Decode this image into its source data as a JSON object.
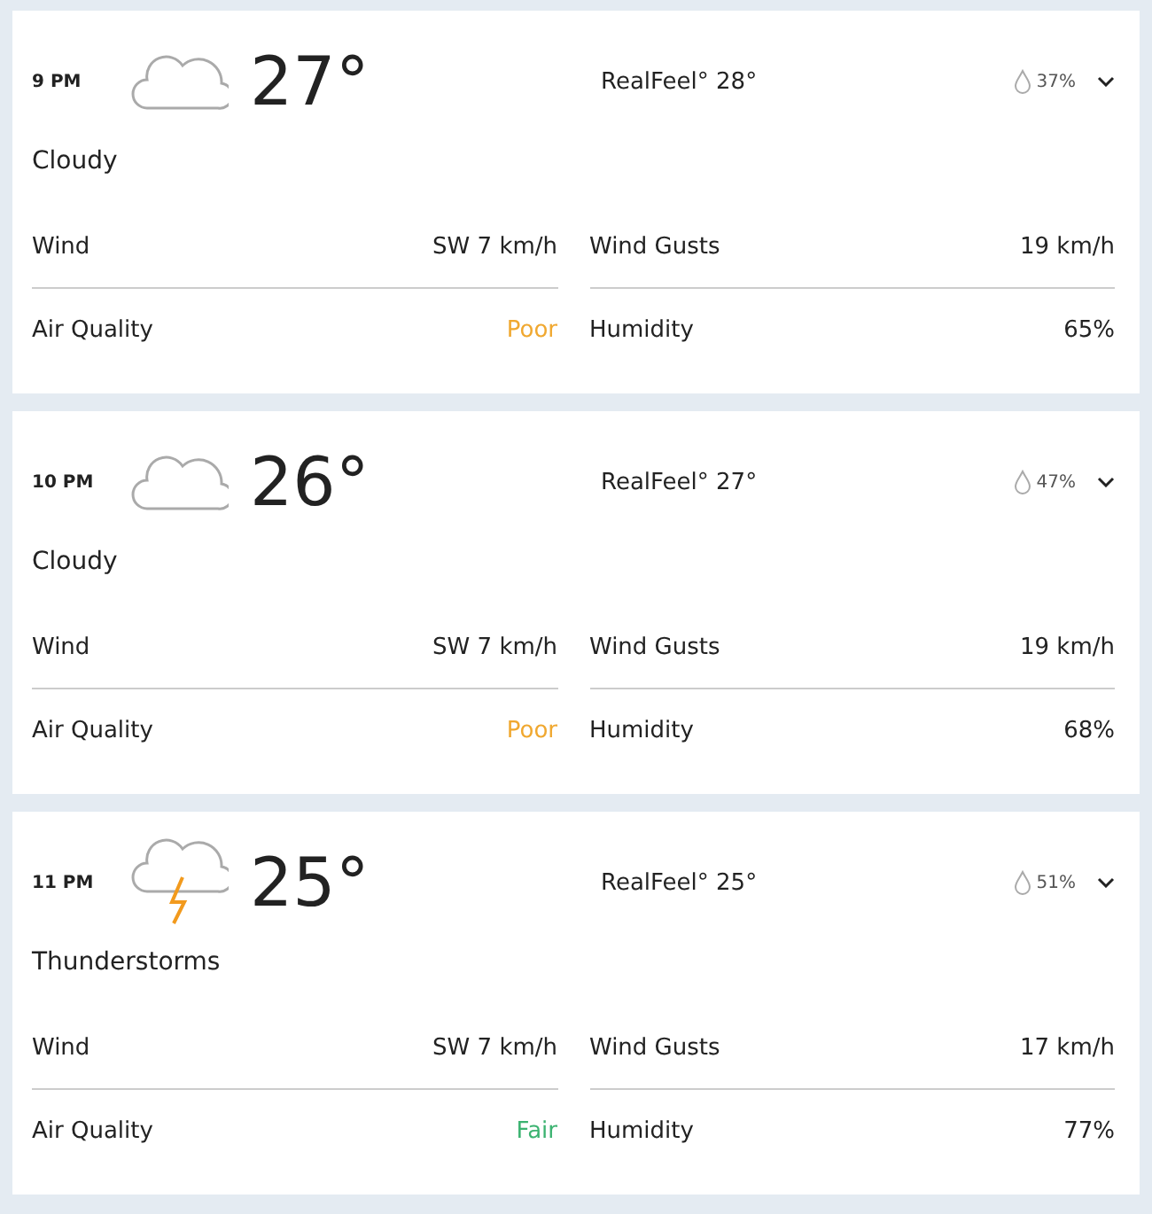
{
  "hours": [
    {
      "time": "9 PM",
      "kind": "cloud",
      "temp": "27°",
      "realfeel": "RealFeel° 28°",
      "precip": "37%",
      "condition": "Cloudy",
      "details": [
        {
          "label": "Wind",
          "value": "SW 7 km/h"
        },
        {
          "label": "Wind Gusts",
          "value": "19 km/h"
        },
        {
          "label": "Air Quality",
          "value": "Poor",
          "color": "#f0a830"
        },
        {
          "label": "Humidity",
          "value": "65%"
        }
      ]
    },
    {
      "time": "10 PM",
      "kind": "cloud",
      "temp": "26°",
      "realfeel": "RealFeel° 27°",
      "precip": "47%",
      "condition": "Cloudy",
      "details": [
        {
          "label": "Wind",
          "value": "SW 7 km/h"
        },
        {
          "label": "Wind Gusts",
          "value": "19 km/h"
        },
        {
          "label": "Air Quality",
          "value": "Poor",
          "color": "#f0a830"
        },
        {
          "label": "Humidity",
          "value": "68%"
        }
      ]
    },
    {
      "time": "11 PM",
      "kind": "thunder",
      "temp": "25°",
      "realfeel": "RealFeel° 25°",
      "precip": "51%",
      "condition": "Thunderstorms",
      "details": [
        {
          "label": "Wind",
          "value": "SW 7 km/h"
        },
        {
          "label": "Wind Gusts",
          "value": "17 km/h"
        },
        {
          "label": "Air Quality",
          "value": "Fair",
          "color": "#3cb371"
        },
        {
          "label": "Humidity",
          "value": "77%"
        }
      ]
    }
  ]
}
